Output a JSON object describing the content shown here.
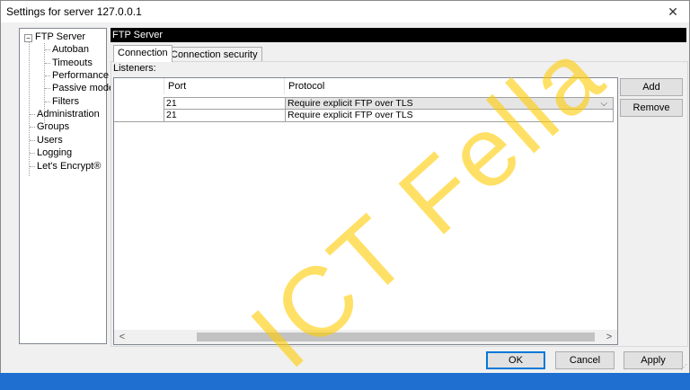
{
  "window": {
    "title": "Settings for server 127.0.0.1",
    "close_glyph": "✕"
  },
  "tree": {
    "expander_glyph": "−",
    "root": "FTP Server",
    "children": [
      "Autoban",
      "Timeouts",
      "Performance",
      "Passive mode",
      "Filters"
    ],
    "items": [
      "Administration",
      "Groups",
      "Users",
      "Logging",
      "Let's Encrypt®"
    ]
  },
  "pane": {
    "header": "FTP Server",
    "tabs": [
      "Connection",
      "Connection security"
    ],
    "active_tab": "Connection",
    "listeners_label": "Listeners:"
  },
  "grid": {
    "columns": [
      "",
      "Port",
      "Protocol"
    ],
    "rows": [
      {
        "address": "",
        "port": "21",
        "protocol": "Require explicit FTP over TLS",
        "selected": true
      },
      {
        "address": "",
        "port": "21",
        "protocol": "Require explicit FTP over TLS",
        "selected": false
      }
    ],
    "dropdown_glyph": "⌵",
    "scroll_left_glyph": "<",
    "scroll_right_glyph": ">"
  },
  "side_buttons": {
    "add": "Add",
    "remove": "Remove"
  },
  "footer": {
    "ok": "OK",
    "cancel": "Cancel",
    "apply": "Apply"
  },
  "watermark": "ICT Fella",
  "colors": {
    "accent": "#0078d7",
    "header_bg": "#000000",
    "desktop": "#1e6fd0",
    "watermark": "#ffcc00"
  }
}
